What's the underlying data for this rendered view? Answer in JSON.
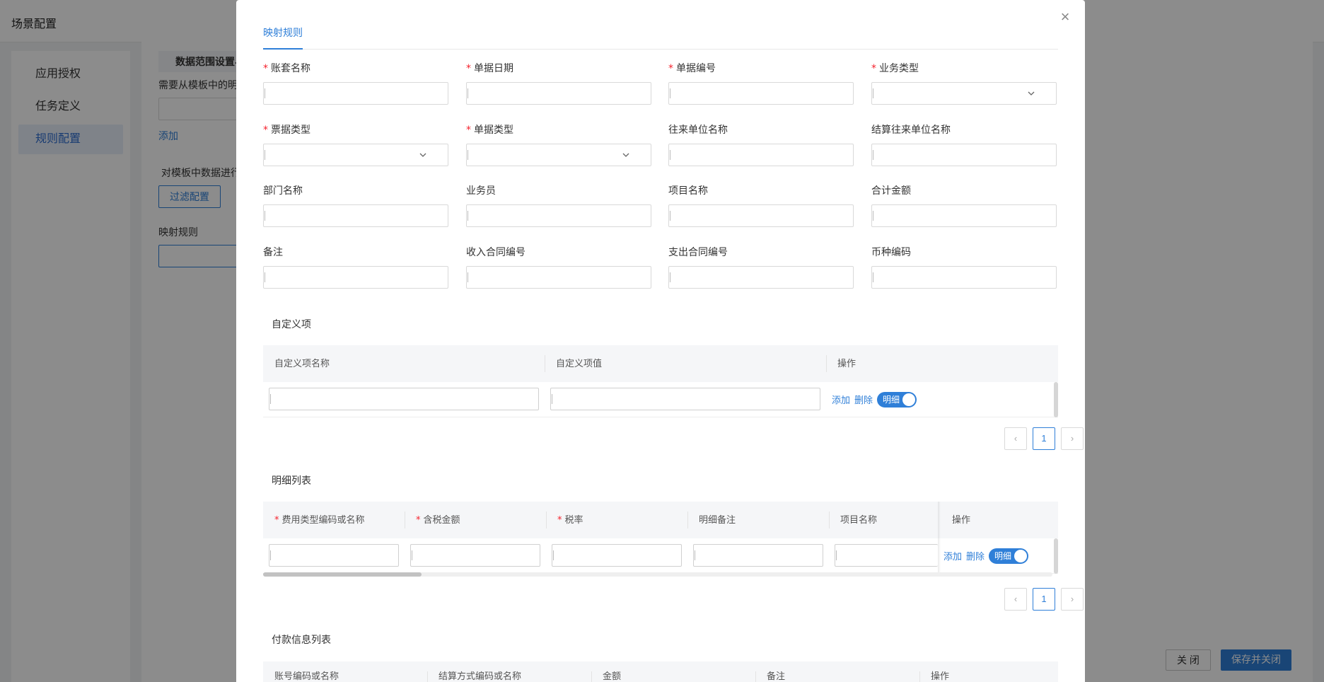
{
  "background": {
    "title": "场景配置",
    "sidebar": [
      "应用授权",
      "任务定义",
      "规则配置"
    ],
    "section_title": "数据范围设置与过",
    "hint1": "需要从模板中的明",
    "add_link": "添加",
    "hint2": "对模板中数据进行",
    "filter_button": "过滤配置",
    "mapping_label": "映射规则",
    "close_button": "关 闭",
    "save_close_button": "保存并关闭"
  },
  "modal": {
    "tab": "映射规则",
    "fields": [
      {
        "label": "账套名称",
        "required": true,
        "select": false
      },
      {
        "label": "单据日期",
        "required": true,
        "select": false
      },
      {
        "label": "单据编号",
        "required": true,
        "select": false
      },
      {
        "label": "业务类型",
        "required": true,
        "select": true
      },
      {
        "label": "票据类型",
        "required": true,
        "select": true
      },
      {
        "label": "单据类型",
        "required": true,
        "select": true
      },
      {
        "label": "往来单位名称",
        "required": false,
        "select": false
      },
      {
        "label": "结算往来单位名称",
        "required": false,
        "select": false
      },
      {
        "label": "部门名称",
        "required": false,
        "select": false
      },
      {
        "label": "业务员",
        "required": false,
        "select": false
      },
      {
        "label": "项目名称",
        "required": false,
        "select": false
      },
      {
        "label": "合计金额",
        "required": false,
        "select": false
      },
      {
        "label": "备注",
        "required": false,
        "select": false
      },
      {
        "label": "收入合同编号",
        "required": false,
        "select": false
      },
      {
        "label": "支出合同编号",
        "required": false,
        "select": false
      },
      {
        "label": "币种编码",
        "required": false,
        "select": false
      }
    ],
    "custom": {
      "title": "自定义项",
      "headers": [
        "自定义项名称",
        "自定义项值",
        "操作"
      ],
      "add": "添加",
      "delete": "删除",
      "toggle": "明细",
      "page": "1"
    },
    "detail": {
      "title": "明细列表",
      "headers": [
        {
          "label": "费用类型编码或名称",
          "required": true
        },
        {
          "label": "含税金额",
          "required": true
        },
        {
          "label": "税率",
          "required": true
        },
        {
          "label": "明细备注",
          "required": false
        },
        {
          "label": "项目名称",
          "required": false
        },
        {
          "label": "操作",
          "required": false
        }
      ],
      "add": "添加",
      "delete": "删除",
      "toggle": "明细",
      "page": "1"
    },
    "payment": {
      "title": "付款信息列表",
      "headers": [
        "账号编码或名称",
        "结算方式编码或名称",
        "金额",
        "备注",
        "操作"
      ]
    }
  }
}
